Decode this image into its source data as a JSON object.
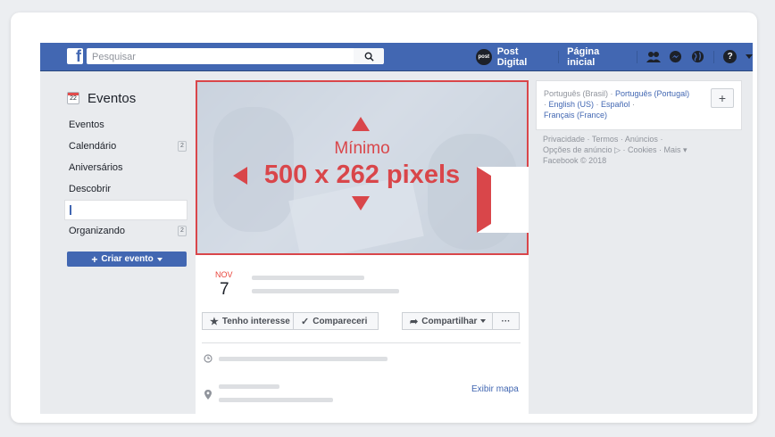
{
  "header": {
    "search_placeholder": "Pesquisar",
    "page_name": "Post Digital",
    "home": "Página inicial",
    "avatar_text": "post"
  },
  "sidebar": {
    "title": "Eventos",
    "calendar_icon_day": "22",
    "items": [
      {
        "label": "Eventos"
      },
      {
        "label": "Calendário",
        "badge": "2"
      },
      {
        "label": "Aniversários"
      },
      {
        "label": "Descobrir"
      },
      {
        "label": "Organizando",
        "badge": "2"
      }
    ],
    "create_button": "Criar evento"
  },
  "cover": {
    "label_min": "Mínimo",
    "label_size": "500 x 262 pixels"
  },
  "event": {
    "month": "NOV",
    "day": "7",
    "interest_button": "Tenho interesse",
    "attended_button": "Compareceri",
    "share_button": "Compartilhar",
    "more_button": "···",
    "map_link": "Exibir mapa"
  },
  "languages": {
    "current": "Português (Brasil)",
    "others": [
      "Português (Portugal)",
      "English (US)",
      "Español",
      "Français (France)"
    ]
  },
  "footer": {
    "links": [
      "Privacidade",
      "Termos",
      "Anúncios",
      "Opções de anúncio",
      "Cookies",
      "Mais"
    ],
    "copyright": "Facebook © 2018"
  },
  "colors": {
    "brand": "#4267b2",
    "accent_red": "#d9464a"
  }
}
